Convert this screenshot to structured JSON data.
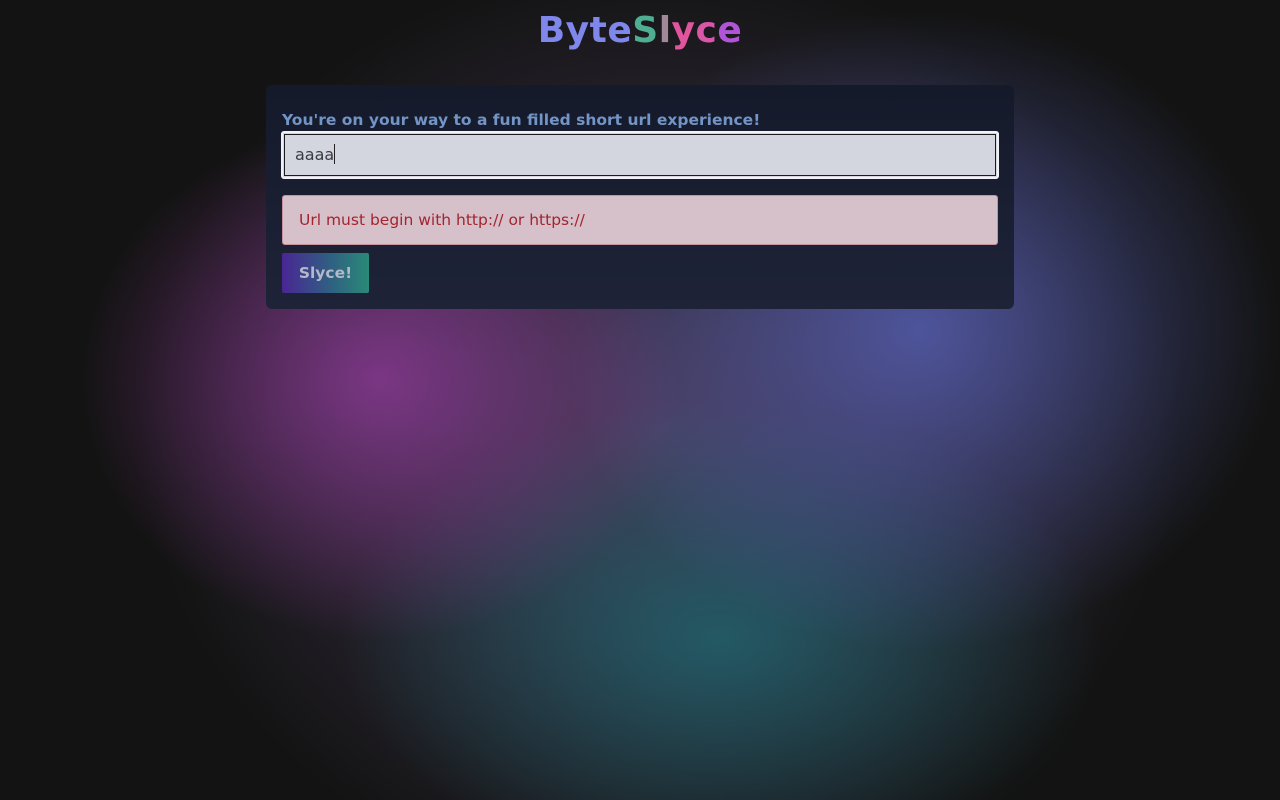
{
  "app": {
    "title_parts": [
      {
        "text": "Byte",
        "color": "#7f87ea"
      },
      {
        "text": "S",
        "color": "#4fae92"
      },
      {
        "text": "l",
        "color": "#a08898"
      },
      {
        "text": "y",
        "color": "#e0559e"
      },
      {
        "text": "c",
        "color": "#d956a8"
      },
      {
        "text": "e",
        "color": "#b154d8"
      }
    ]
  },
  "form": {
    "prompt": "You're on your way to a fun filled short url experience!",
    "url_value": "aaaa",
    "error_message": "Url must begin with http:// or https://",
    "submit_label": "Slyce!"
  }
}
